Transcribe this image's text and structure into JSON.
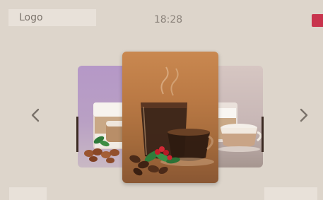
{
  "header": {
    "logo_label": "Logo",
    "time": "18:28"
  },
  "carousel": {
    "prev_icon": "chevron-left-icon",
    "next_icon": "chevron-right-icon",
    "items": [
      {
        "image": "latte-macchiato-with-nuts",
        "position": "left"
      },
      {
        "image": "black-coffee-with-beans",
        "position": "center"
      },
      {
        "image": "cafe-latte-cup",
        "position": "right"
      }
    ]
  },
  "colors": {
    "background": "#ddd5cb",
    "accent_flag": "#c8344d",
    "left_card": "#b598c7",
    "center_card": "#bb7a45",
    "right_card": "#c8b7b6"
  }
}
